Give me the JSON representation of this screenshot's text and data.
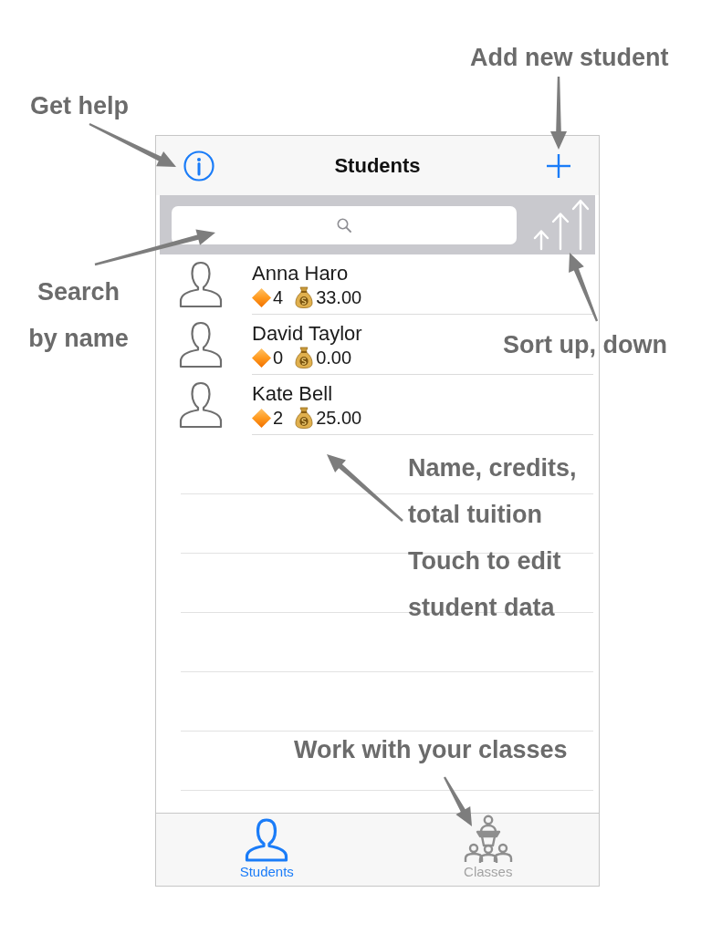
{
  "annotations": [
    {
      "text": "Add new student"
    },
    {
      "text": "Get help"
    },
    {
      "text": "Search by name"
    },
    {
      "text": "Sort up, down"
    },
    {
      "text": "Name, credits, total tuition"
    },
    {
      "text": "Touch to edit student data"
    },
    {
      "text": "Work with your classes"
    }
  ],
  "nav_bar": {
    "title": "Students"
  },
  "students": [
    {
      "name": "Anna Haro",
      "credits": "4",
      "tuition": "33.00"
    },
    {
      "name": "David Taylor",
      "credits": "0",
      "tuition": "0.00"
    },
    {
      "name": "Kate Bell",
      "credits": "2",
      "tuition": "25.00"
    }
  ],
  "tab_bar": {
    "tabs": [
      {
        "label": "Students",
        "selected": true
      },
      {
        "label": "Classes",
        "selected": false
      }
    ]
  }
}
